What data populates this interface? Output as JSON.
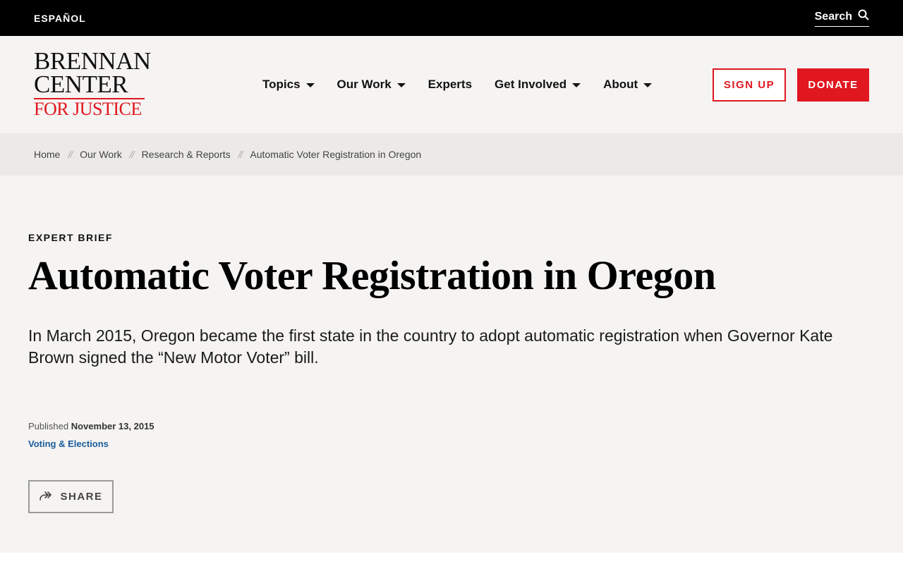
{
  "topbar": {
    "language_link": "ESPAÑOL",
    "search_label": "Search",
    "search_icon": "search-icon"
  },
  "logo": {
    "line1": "BRENNAN",
    "line2": "CENTER",
    "line3": "FOR JUSTICE",
    "accent_color": "#e0171f"
  },
  "nav": {
    "items": [
      {
        "label": "Topics",
        "has_dropdown": true
      },
      {
        "label": "Our Work",
        "has_dropdown": true
      },
      {
        "label": "Experts",
        "has_dropdown": false
      },
      {
        "label": "Get Involved",
        "has_dropdown": true
      },
      {
        "label": "About",
        "has_dropdown": true
      }
    ],
    "signup_label": "SIGN UP",
    "donate_label": "DONATE"
  },
  "breadcrumb": {
    "separator": "//",
    "items": [
      "Home",
      "Our Work",
      "Research & Reports",
      "Automatic Voter Registration in Oregon"
    ]
  },
  "article": {
    "eyebrow": "EXPERT BRIEF",
    "title": "Automatic Voter Registration in Oregon",
    "dek": "In March 2015, Oregon became the first state in the country to adopt automatic registration when Governor Kate Brown signed the “New Motor Voter” bill.",
    "published_prefix": "Published",
    "published_date": "November 13, 2015",
    "topic": "Voting & Elections",
    "share_label": "SHARE"
  },
  "colors": {
    "brand_red": "#e0171f",
    "link_blue": "#1a5b9c",
    "background": "#f5f4f2"
  }
}
